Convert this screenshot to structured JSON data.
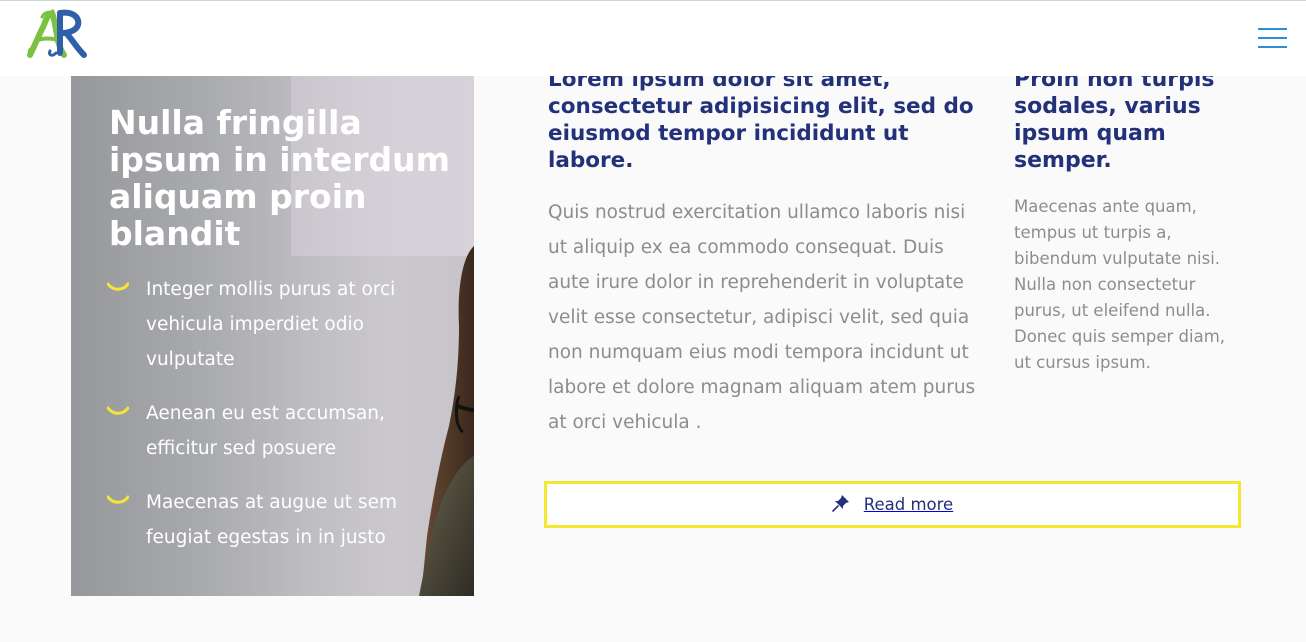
{
  "header": {
    "logo_text": "AR",
    "menu_icon": "hamburger-menu-icon",
    "accent_color": "#2b8fd6"
  },
  "hero": {
    "title": "Nulla fringilla ipsum in interdum aliquam proin blandit",
    "bullet_icon": "smile-curve-icon",
    "bullet_color": "#f5e633",
    "items": [
      "Integer mollis purus at orci vehicula imperdiet odio vulputate",
      "Aenean eu est accumsan, efficitur sed posuere",
      "Maecenas at augue ut sem feugiat egestas in in justo"
    ]
  },
  "main": {
    "heading": "Lorem ipsum dolor sit amet, consectetur adipisicing elit, sed do eiusmod tempor incididunt ut labore.",
    "body": "Quis nostrud exercitation ullamco laboris nisi ut aliquip ex ea commodo consequat. Duis aute irure dolor in reprehenderit in voluptate velit esse consectetur, adipisci velit, sed quia non numquam eius modi tempora incidunt ut labore et dolore magnam aliquam atem purus at orci vehicula ."
  },
  "aside": {
    "heading": "Proin non turpis sodales, varius ipsum quam semper.",
    "body": "Maecenas ante quam, tempus ut turpis a, bibendum vulputate nisi. Nulla non consectetur purus, ut eleifend nulla. Donec quis semper diam, ut cursus ipsum."
  },
  "read_more": {
    "label": "Read more",
    "icon": "pushpin-icon",
    "border_color": "#f5e633"
  },
  "colors": {
    "heading": "#23307a",
    "body_text": "#8d8d8d"
  }
}
